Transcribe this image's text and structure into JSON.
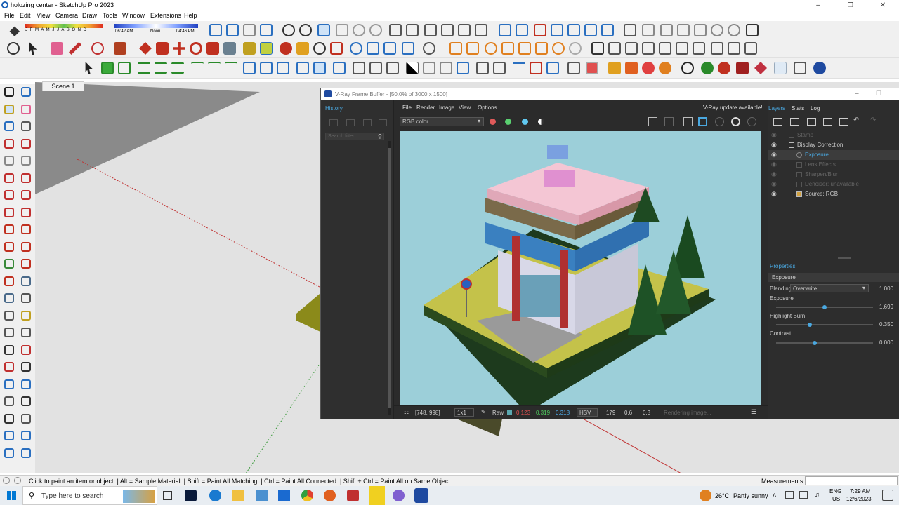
{
  "app": {
    "title": "holozing center - SketchUp Pro 2023"
  },
  "menu": [
    "File",
    "Edit",
    "View",
    "Camera",
    "Draw",
    "Tools",
    "Window",
    "Extensions",
    "Help"
  ],
  "shadow_bar": {
    "months": "J F M A M J J A S O N D",
    "time_start": "06:42 AM",
    "time_mid": "Noon",
    "time_end": "04:46 PM"
  },
  "scene_tab": "Scene 1",
  "status": {
    "hint": "Click to paint an item or object. | Alt = Sample Material. | Shift = Paint All Matching. | Ctrl = Paint All Connected. | Shift + Ctrl = Paint All on Same Object.",
    "measurements_label": "Measurements"
  },
  "taskbar": {
    "search_placeholder": "Type here to search",
    "weather": "26°C",
    "weather_desc": "Partly sunny",
    "lang": "ENG",
    "region": "US",
    "time": "7:29 AM",
    "date": "12/6/2023"
  },
  "vfb": {
    "title": "V-Ray Frame Buffer - [50.0% of 3000 x 1500]",
    "history_label": "History",
    "search_filter_placeholder": "Search filter",
    "menu": [
      "File",
      "Render",
      "Image",
      "View",
      "Options"
    ],
    "update_notice": "V-Ray update available!",
    "channel": "RGB color",
    "panel_tabs": [
      "Layers",
      "Stats",
      "Log"
    ],
    "layers": [
      {
        "name": "Stamp",
        "visible": false,
        "indent": 1
      },
      {
        "name": "Display Correction",
        "visible": true,
        "indent": 1
      },
      {
        "name": "Exposure",
        "visible": true,
        "indent": 2,
        "selected": true
      },
      {
        "name": "Lens Effects",
        "visible": false,
        "indent": 2
      },
      {
        "name": "Sharpen/Blur",
        "visible": false,
        "indent": 2
      },
      {
        "name": "Denoiser: unavailable",
        "visible": false,
        "indent": 2
      },
      {
        "name": "Source: RGB",
        "visible": true,
        "indent": 1
      }
    ],
    "properties_label": "Properties",
    "prop_header": "Exposure",
    "blending_label": "Blending",
    "blending_mode": "Overwrite",
    "blending_value": "1.000",
    "props": [
      {
        "label": "Exposure",
        "value": "1.699",
        "level": 0.5
      },
      {
        "label": "Highlight Burn",
        "value": "0.350",
        "level": 0.35
      },
      {
        "label": "Contrast",
        "value": "0.000",
        "level": 0.4
      }
    ],
    "footer": {
      "coords": "[748, 998]",
      "zoom": "1x1",
      "mode": "Raw",
      "r": "0.123",
      "g": "0.319",
      "b": "0.318",
      "colorspace": "HSV",
      "h": "179",
      "s": "0.6",
      "v": "0.3",
      "status": "Rendering image..."
    }
  }
}
